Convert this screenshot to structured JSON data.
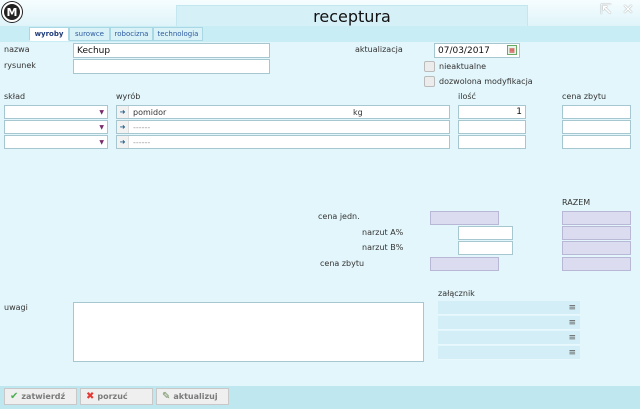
{
  "window": {
    "title": "receptura",
    "logo_letter": "M"
  },
  "tabs": [
    {
      "label": "wyroby",
      "active": true
    },
    {
      "label": "surowce",
      "active": false
    },
    {
      "label": "robocizna",
      "active": false
    },
    {
      "label": "technologia",
      "active": false
    }
  ],
  "form": {
    "nazwa_label": "nazwa",
    "nazwa_value": "Kechup",
    "rysunek_label": "rysunek",
    "rysunek_value": "",
    "aktualizacja_label": "aktualizacja",
    "aktualizacja_value": "07/03/2017",
    "nieaktualne_label": "nieaktualne",
    "dozwolona_label": "dozwolona modyfikacja"
  },
  "columns": {
    "sklad": "skład",
    "wyrob": "wyrób",
    "ilosc": "ilość",
    "cena_zbytu": "cena zbytu"
  },
  "rows": [
    {
      "sklad": "",
      "wyrob": "pomidor",
      "unit": "kg",
      "ilosc": "1",
      "cena": ""
    },
    {
      "sklad": "",
      "wyrob": "------",
      "unit": "",
      "ilosc": "",
      "cena": ""
    },
    {
      "sklad": "",
      "wyrob": "------",
      "unit": "",
      "ilosc": "",
      "cena": ""
    }
  ],
  "summary": {
    "razem_label": "RAZEM",
    "cena_jedn_label": "cena jedn.",
    "narzut_a_label": "narzut A%",
    "narzut_b_label": "narzut B%",
    "cena_zbytu_label": "cena zbytu"
  },
  "uwagi_label": "uwagi",
  "zalacznik_label": "załącznik",
  "footer": {
    "zatwierdz": "zatwierdź",
    "porzuc": "porzuć",
    "aktualizuj": "aktualizuj"
  },
  "colors": {
    "background": "#e3f6fb",
    "accent": "#2c5aa0",
    "grey_field": "#dcdcf0"
  }
}
